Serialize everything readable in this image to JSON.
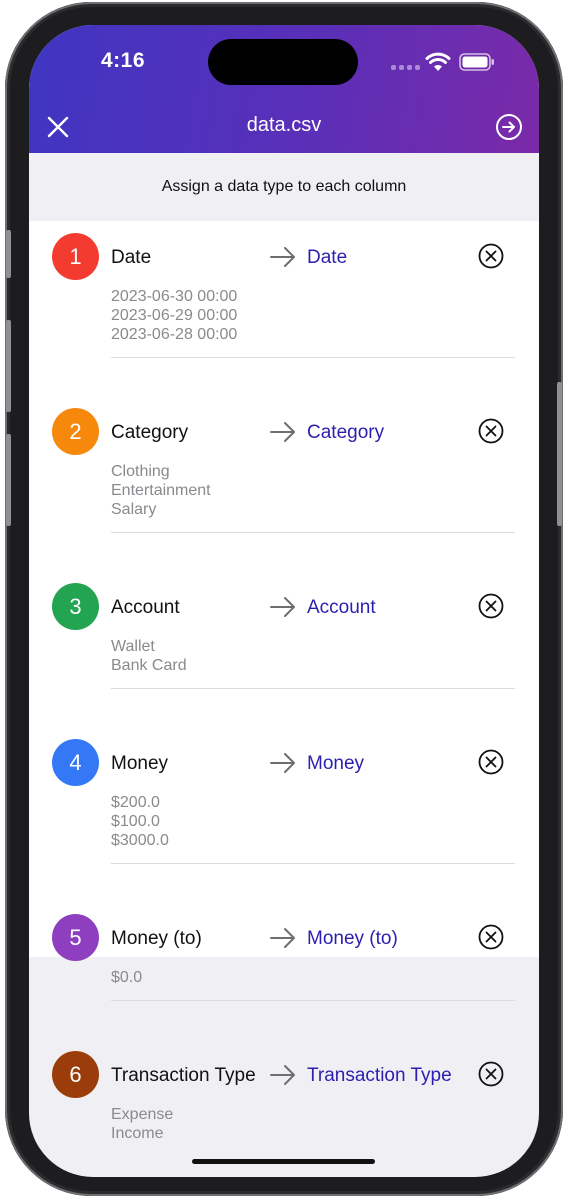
{
  "status_bar": {
    "time": "4:16"
  },
  "header": {
    "title": "data.csv",
    "close_icon": "close-icon",
    "next_icon": "arrow-right-circle-icon"
  },
  "subtitle": "Assign a data type to each column",
  "columns": [
    {
      "index": "1",
      "color": "#f43b30",
      "name": "Date",
      "mapped_to": "Date",
      "samples": [
        "2023-06-30 00:00",
        "2023-06-29 00:00",
        "2023-06-28 00:00"
      ]
    },
    {
      "index": "2",
      "color": "#f6880c",
      "name": "Category",
      "mapped_to": "Category",
      "samples": [
        "Clothing",
        "Entertainment",
        "Salary"
      ]
    },
    {
      "index": "3",
      "color": "#22a450",
      "name": "Account",
      "mapped_to": "Account",
      "samples": [
        "Wallet",
        "Bank Card"
      ]
    },
    {
      "index": "4",
      "color": "#3478f6",
      "name": "Money",
      "mapped_to": "Money",
      "samples": [
        "$200.0",
        "$100.0",
        "$3000.0"
      ]
    },
    {
      "index": "5",
      "color": "#8e3fbf",
      "name": "Money (to)",
      "mapped_to": "Money (to)",
      "samples": [
        "$0.0"
      ]
    },
    {
      "index": "6",
      "color": "#9a3d0a",
      "name": "Transaction Type",
      "mapped_to": "Transaction Type",
      "samples": [
        "Expense",
        "Income"
      ]
    }
  ]
}
